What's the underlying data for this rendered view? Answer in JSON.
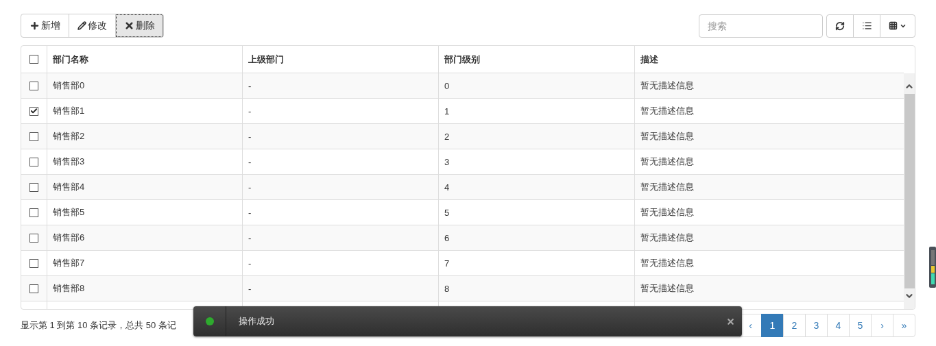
{
  "toolbar": {
    "buttons": [
      {
        "kind": "add",
        "label": "新增",
        "active": false
      },
      {
        "kind": "edit",
        "label": "修改",
        "active": false
      },
      {
        "kind": "delete",
        "label": "删除",
        "active": true
      }
    ],
    "search": {
      "placeholder": "搜索"
    },
    "tools": [
      {
        "kind": "refresh"
      },
      {
        "kind": "toggle"
      },
      {
        "kind": "columns"
      }
    ]
  },
  "table": {
    "select_all": {
      "checked": false
    },
    "columns": [
      "部门名称",
      "上级部门",
      "部门级别",
      "描述"
    ],
    "rows": [
      {
        "checked": false,
        "cells": [
          "销售部0",
          "-",
          "0",
          "暂无描述信息"
        ]
      },
      {
        "checked": true,
        "cells": [
          "销售部1",
          "-",
          "1",
          "暂无描述信息"
        ]
      },
      {
        "checked": false,
        "cells": [
          "销售部2",
          "-",
          "2",
          "暂无描述信息"
        ]
      },
      {
        "checked": false,
        "cells": [
          "销售部3",
          "-",
          "3",
          "暂无描述信息"
        ]
      },
      {
        "checked": false,
        "cells": [
          "销售部4",
          "-",
          "4",
          "暂无描述信息"
        ]
      },
      {
        "checked": false,
        "cells": [
          "销售部5",
          "-",
          "5",
          "暂无描述信息"
        ]
      },
      {
        "checked": false,
        "cells": [
          "销售部6",
          "-",
          "6",
          "暂无描述信息"
        ]
      },
      {
        "checked": false,
        "cells": [
          "销售部7",
          "-",
          "7",
          "暂无描述信息"
        ]
      },
      {
        "checked": false,
        "cells": [
          "销售部8",
          "-",
          "8",
          "暂无描述信息"
        ]
      }
    ]
  },
  "footer": {
    "summary": "显示第 1 到第 10 条记录，总共 50 条记",
    "pager": [
      {
        "label": "‹",
        "selected": false
      },
      {
        "label": "1",
        "selected": true
      },
      {
        "label": "2",
        "selected": false
      },
      {
        "label": "3",
        "selected": false
      },
      {
        "label": "4",
        "selected": false
      },
      {
        "label": "5",
        "selected": false
      },
      {
        "label": "›",
        "selected": false
      },
      {
        "label": "»",
        "selected": false
      }
    ]
  },
  "toast": {
    "message": "操作成功",
    "kind": "success"
  }
}
